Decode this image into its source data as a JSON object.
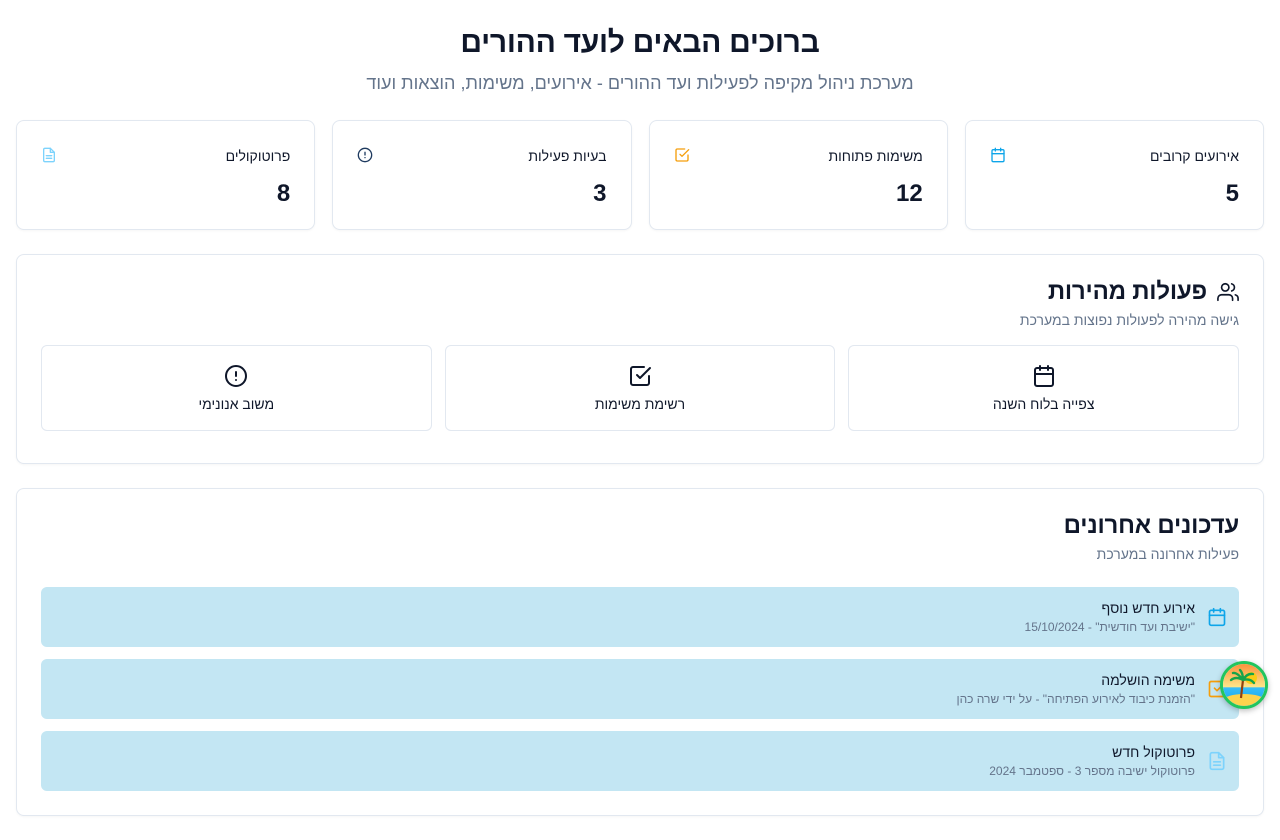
{
  "header": {
    "title": "ברוכים הבאים לועד ההורים",
    "subtitle": "מערכת ניהול מקיפה לפעילות ועד ההורים - אירועים, משימות, הוצאות ועוד"
  },
  "stats": [
    {
      "label": "אירועים קרובים",
      "value": "5",
      "icon": "calendar-icon",
      "color": "#0ea5e9"
    },
    {
      "label": "משימות פתוחות",
      "value": "12",
      "icon": "check-square-icon",
      "color": "#f59e0b"
    },
    {
      "label": "בעיות פעילות",
      "value": "3",
      "icon": "alert-circle-icon",
      "color": "#1e3a5f"
    },
    {
      "label": "פרוטוקולים",
      "value": "8",
      "icon": "file-text-icon",
      "color": "#7dd3fc"
    }
  ],
  "quick_actions": {
    "title": "פעולות מהירות",
    "subtitle": "גישה מהירה לפעולות נפוצות במערכת",
    "icon": "users-icon",
    "buttons": [
      {
        "label": "צפייה בלוח השנה",
        "icon": "calendar-icon"
      },
      {
        "label": "רשימת משימות",
        "icon": "check-square-icon"
      },
      {
        "label": "משוב אנונימי",
        "icon": "alert-circle-icon"
      }
    ]
  },
  "updates": {
    "title": "עדכונים אחרונים",
    "subtitle": "פעילות אחרונה במערכת",
    "items": [
      {
        "title": "אירוע חדש נוסף",
        "desc": "\"ישיבת ועד חודשית\" - 15/10/2024",
        "icon": "calendar-icon",
        "color": "#0ea5e9"
      },
      {
        "title": "משימה הושלמה",
        "desc": "\"הזמנת כיבוד לאירוע הפתיחה\" - על ידי שרה כהן",
        "icon": "check-square-icon",
        "color": "#f59e0b"
      },
      {
        "title": "פרוטוקול חדש",
        "desc": "פרוטוקול ישיבה מספר 3 - ספטמבר 2024",
        "icon": "file-text-icon",
        "color": "#7dd3fc"
      }
    ]
  },
  "colors": {
    "update_bg": "#c3e6f3",
    "border": "#e2e8f0",
    "muted_text": "#64748b"
  }
}
